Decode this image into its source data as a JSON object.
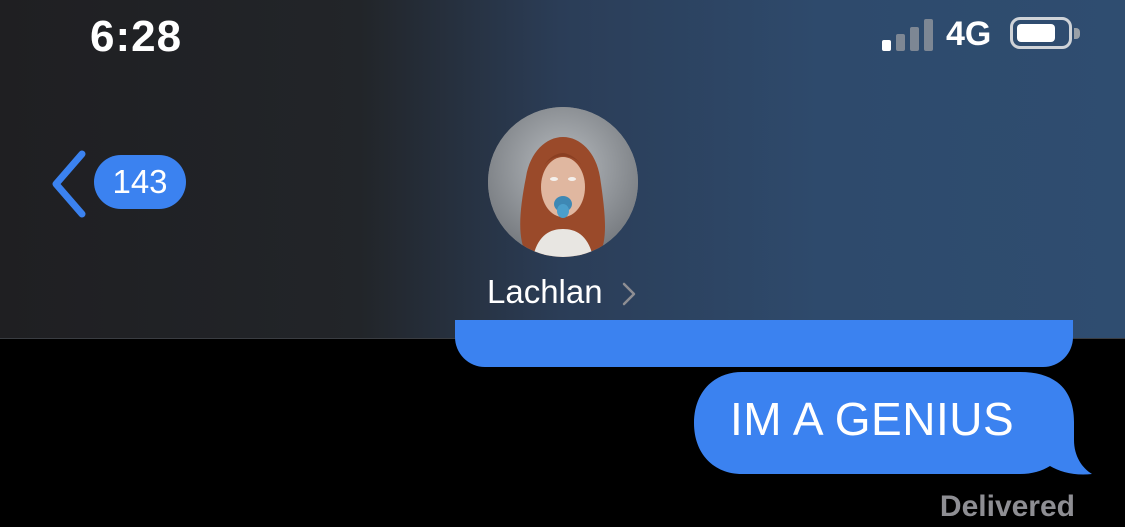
{
  "status_bar": {
    "time": "6:28",
    "network": "4G",
    "signal_bars_active": 1,
    "signal_bars_total": 4,
    "battery_level": 0.8
  },
  "header": {
    "back_icon": "chevron-left-icon",
    "unread_count": "143",
    "contact_name": "Lachlan",
    "contact_chevron_icon": "chevron-right-icon"
  },
  "messages": [
    {
      "id": "previous",
      "text": "",
      "sender": "me"
    },
    {
      "id": "latest",
      "text": "IM A GENIUS",
      "sender": "me"
    }
  ],
  "delivery_status": "Delivered",
  "colors": {
    "accent_blue": "#3b82f0",
    "bubble_blue": "#3b82f0",
    "status_gray": "#8e8e93",
    "background": "#000000"
  }
}
